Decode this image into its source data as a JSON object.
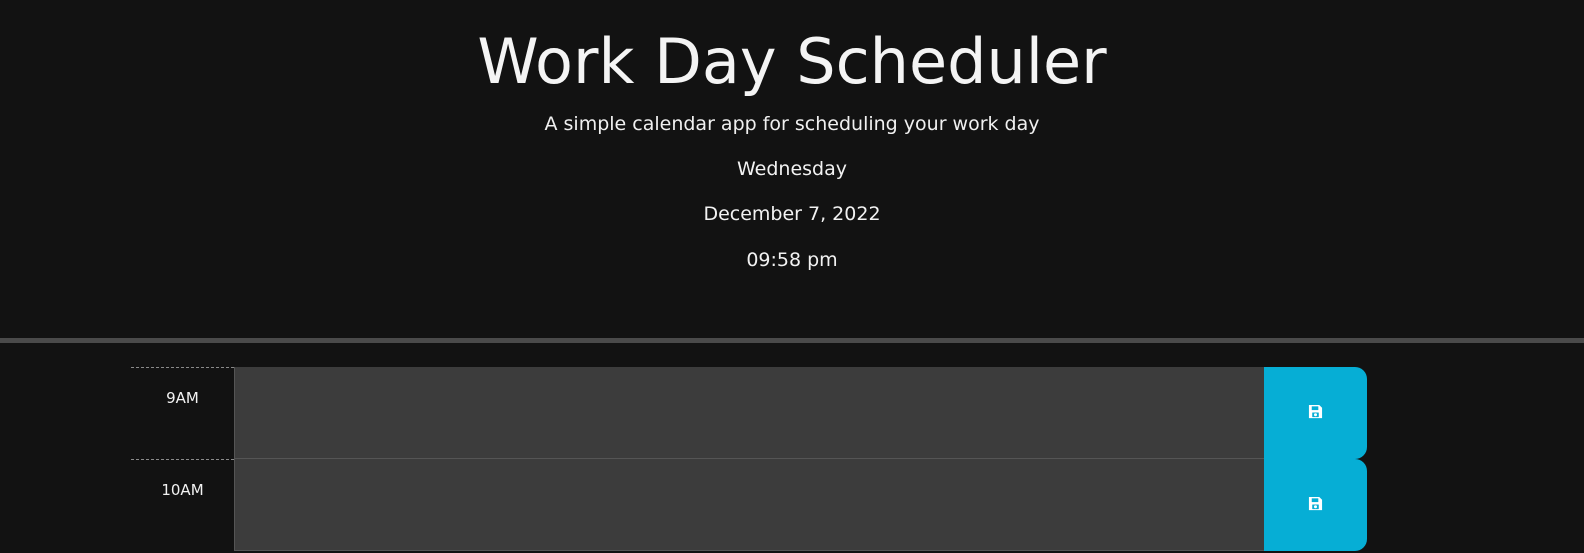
{
  "header": {
    "title": "Work Day Scheduler",
    "subtitle": "A simple calendar app for scheduling your work day",
    "day": "Wednesday",
    "date": "December 7, 2022",
    "time": "09:58 pm"
  },
  "colors": {
    "background": "#121212",
    "text_area": "#3c3c3c",
    "save_button": "#06aed5"
  },
  "rows": [
    {
      "hour": "9AM",
      "text": "",
      "save_icon": "floppy-disk-icon"
    },
    {
      "hour": "10AM",
      "text": "",
      "save_icon": "floppy-disk-icon"
    }
  ]
}
